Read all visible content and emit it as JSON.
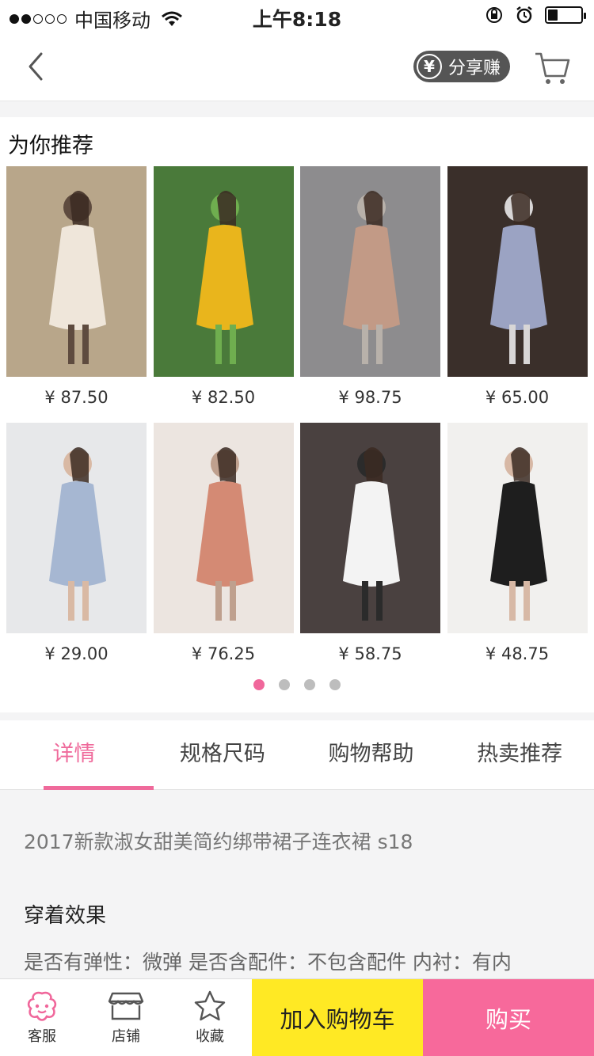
{
  "status_bar": {
    "carrier": "中国移动",
    "time": "上午8:18",
    "battery_level": 0.3
  },
  "nav": {
    "share_label": "分享赚",
    "yen_symbol": "¥"
  },
  "recommend": {
    "title": "为你推荐",
    "products": [
      {
        "price": "¥ 87.50",
        "colors": [
          "#b8a68a",
          "#efe6da",
          "#5e4b3f"
        ]
      },
      {
        "price": "¥ 82.50",
        "colors": [
          "#4a7a3a",
          "#e9b51c",
          "#6fae4f"
        ]
      },
      {
        "price": "¥ 98.75",
        "colors": [
          "#8d8c8e",
          "#c29a86",
          "#b8b1aa"
        ]
      },
      {
        "price": "¥ 65.00",
        "colors": [
          "#3a2f2a",
          "#9ba3c3",
          "#d8d6d6"
        ]
      },
      {
        "price": "¥ 29.00",
        "colors": [
          "#e7e8ea",
          "#a6b7d2",
          "#d9b9a4"
        ]
      },
      {
        "price": "¥ 76.25",
        "colors": [
          "#ece5e0",
          "#d48a74",
          "#bfa08e"
        ]
      },
      {
        "price": "¥ 58.75",
        "colors": [
          "#4a4140",
          "#f3f3f3",
          "#2b2b2b"
        ]
      },
      {
        "price": "¥ 48.75",
        "colors": [
          "#f1f0ee",
          "#1e1e1e",
          "#d7b8a5"
        ]
      }
    ],
    "page_count": 4,
    "active_page": 1
  },
  "tabs": [
    {
      "label": "详情",
      "active": true
    },
    {
      "label": "规格尺码",
      "active": false
    },
    {
      "label": "购物帮助",
      "active": false
    },
    {
      "label": "热卖推荐",
      "active": false
    }
  ],
  "details": {
    "title": "2017新款淑女甜美简约绑带裙子连衣裙 s18",
    "heading": "穿着效果",
    "line": "是否有弹性：微弹 是否含配件：不包含配件 内衬：有内"
  },
  "bottom_bar": {
    "service_label": "客服",
    "store_label": "店铺",
    "favorite_label": "收藏",
    "add_cart_label": "加入购物车",
    "buy_label": "购买"
  },
  "colors": {
    "accent_pink": "#ef6a9b",
    "cart_yellow": "#ffe924"
  }
}
